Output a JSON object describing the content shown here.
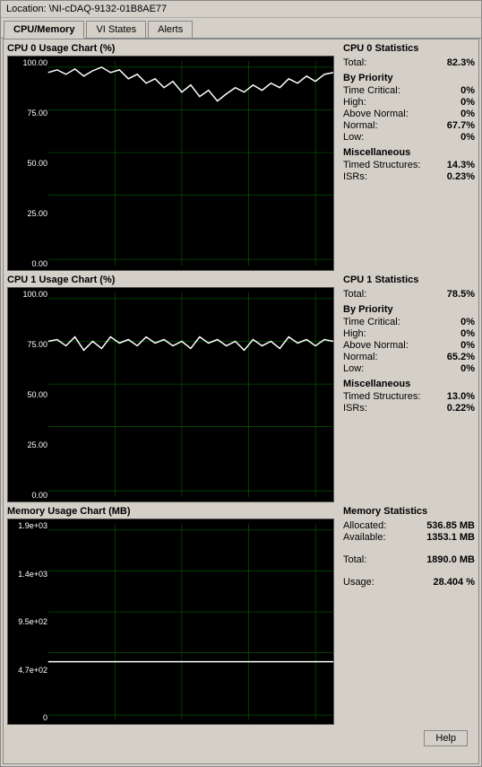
{
  "window": {
    "location_label": "Location:",
    "location_value": "\\NI-cDAQ-9132-01B8AE77"
  },
  "tabs": [
    {
      "label": "CPU/Memory",
      "active": true
    },
    {
      "label": "VI States",
      "active": false
    },
    {
      "label": "Alerts",
      "active": false
    }
  ],
  "cpu0": {
    "chart_title": "CPU 0 Usage Chart (%)",
    "stats_title": "CPU 0 Statistics",
    "y_labels": [
      "100.00",
      "75.00",
      "50.00",
      "25.00",
      "0.00"
    ],
    "total_label": "Total:",
    "total_value": "82.3%",
    "by_priority_label": "By Priority",
    "time_critical_label": "Time Critical:",
    "time_critical_value": "0%",
    "high_label": "High:",
    "high_value": "0%",
    "above_normal_label": "Above Normal:",
    "above_normal_value": "0%",
    "normal_label": "Normal:",
    "normal_value": "67.7%",
    "low_label": "Low:",
    "low_value": "0%",
    "misc_label": "Miscellaneous",
    "timed_label": "Timed Structures:",
    "timed_value": "14.3%",
    "isrs_label": "ISRs:",
    "isrs_value": "0.23%"
  },
  "cpu1": {
    "chart_title": "CPU 1 Usage Chart (%)",
    "stats_title": "CPU 1 Statistics",
    "y_labels": [
      "100.00",
      "75.00",
      "50.00",
      "25.00",
      "0.00"
    ],
    "total_label": "Total:",
    "total_value": "78.5%",
    "by_priority_label": "By Priority",
    "time_critical_label": "Time Critical:",
    "time_critical_value": "0%",
    "high_label": "High:",
    "high_value": "0%",
    "above_normal_label": "Above Normal:",
    "above_normal_value": "0%",
    "normal_label": "Normal:",
    "normal_value": "65.2%",
    "low_label": "Low:",
    "low_value": "0%",
    "misc_label": "Miscellaneous",
    "timed_label": "Timed Structures:",
    "timed_value": "13.0%",
    "isrs_label": "ISRs:",
    "isrs_value": "0.22%"
  },
  "memory": {
    "chart_title": "Memory Usage Chart (MB)",
    "stats_title": "Memory Statistics",
    "y_labels": [
      "1.9e+03",
      "1.4e+03",
      "9.5e+02",
      "4.7e+02",
      "0"
    ],
    "allocated_label": "Allocated:",
    "allocated_value": "536.85 MB",
    "available_label": "Available:",
    "available_value": "1353.1 MB",
    "total_label": "Total:",
    "total_value": "1890.0 MB",
    "usage_label": "Usage:",
    "usage_value": "28.404 %"
  },
  "buttons": {
    "help_label": "Help"
  }
}
